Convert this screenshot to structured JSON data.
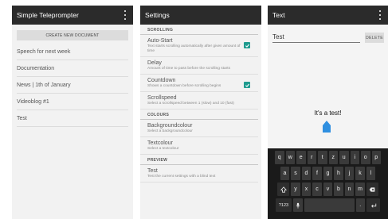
{
  "screen1": {
    "title": "Simple Teleprompter",
    "create_label": "CREATE NEW DOCUMENT",
    "documents": [
      "Speech for next week",
      "Documentation",
      "News | 1th of January",
      "Videoblog #1",
      "Test"
    ]
  },
  "screen2": {
    "title": "Settings",
    "sections": [
      {
        "header": "SCROLLING",
        "items": [
          {
            "title": "Auto-Start",
            "desc": "Text starts scrolling automatically after given amount of time",
            "checked": true
          },
          {
            "title": "Delay",
            "desc": "Amount of time to pass before the scrolling starts",
            "checked": null
          },
          {
            "title": "Countdown",
            "desc": "Shows a countdown before scrolling begins",
            "checked": true
          },
          {
            "title": "Scrollspeed",
            "desc": "Select a scrollspeed between 1 (slow) and 10 (fast)",
            "checked": null
          }
        ]
      },
      {
        "header": "COLOURS",
        "items": [
          {
            "title": "Backgroundcolour",
            "desc": "Select a backgroundcolour",
            "checked": null
          },
          {
            "title": "Textcolour",
            "desc": "Select a textcolour",
            "checked": null
          }
        ]
      },
      {
        "header": "PREVIEW",
        "items": [
          {
            "title": "Test",
            "desc": "Test the current settings with a blind text",
            "checked": null
          }
        ]
      }
    ]
  },
  "screen3": {
    "title": "Text",
    "input_value": "Test",
    "delete_label": "DELETE",
    "preview_text": "It's a test!",
    "keyboard": {
      "row1": [
        "q",
        "w",
        "e",
        "r",
        "t",
        "z",
        "u",
        "i",
        "o",
        "p"
      ],
      "row2": [
        "a",
        "s",
        "d",
        "f",
        "g",
        "h",
        "j",
        "k",
        "l"
      ],
      "row3": [
        "y",
        "x",
        "c",
        "v",
        "b",
        "n",
        "m"
      ],
      "num_label": "?123",
      "space_label": "",
      "period_label": "."
    }
  },
  "colors": {
    "appbar": "#2b2b2b",
    "accent": "#1f9b8f",
    "cursor": "#2f8fe0"
  }
}
